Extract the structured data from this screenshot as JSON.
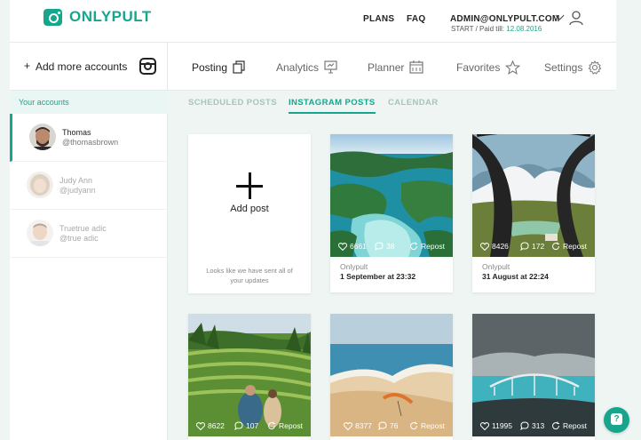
{
  "header": {
    "brand": "ONLYPULT",
    "nav": {
      "plans": "PLANS",
      "faq": "FAQ"
    },
    "account": {
      "email": "ADMIN@ONLYPULT.COM",
      "plan_prefix": "START / Paid till:",
      "paid_till": "12.08.2016"
    }
  },
  "sidebar": {
    "add_accounts_label": "Add more accounts",
    "add_accounts_plus": "+",
    "your_accounts_label": "Your accounts",
    "accounts": [
      {
        "name": "Thomas",
        "handle": "@thomasbrown"
      },
      {
        "name": "Judy Ann",
        "handle": "@judyann"
      },
      {
        "name": "Truetrue adic",
        "handle": "@true adic"
      }
    ]
  },
  "main_tabs": [
    {
      "label": "Posting",
      "icon": "copy-icon"
    },
    {
      "label": "Analytics",
      "icon": "presentation-icon"
    },
    {
      "label": "Planner",
      "icon": "calendar-icon"
    },
    {
      "label": "Favorites",
      "icon": "star-icon"
    },
    {
      "label": "Settings",
      "icon": "gear-icon"
    }
  ],
  "sub_tabs": [
    "SCHEDULED POSTS",
    "INSTAGRAM POSTS",
    "CALENDAR"
  ],
  "add_post": {
    "label": "Add post",
    "note": "Looks like we have sent all of your updates"
  },
  "posts": [
    {
      "likes": "6661",
      "comments": "38",
      "repost": "Repost",
      "account": "Onlypult",
      "date": "1 September at 23:32"
    },
    {
      "likes": "8426",
      "comments": "172",
      "repost": "Repost",
      "account": "Onlypult",
      "date": "31 August at 22:24"
    },
    {
      "likes": "8622",
      "comments": "107",
      "repost": "Repost"
    },
    {
      "likes": "8377",
      "comments": "76",
      "repost": "Repost"
    },
    {
      "likes": "11995",
      "comments": "313",
      "repost": "Repost"
    }
  ],
  "help_label": "?",
  "colors": {
    "accent": "#17a68d",
    "background": "#eef5f3"
  }
}
